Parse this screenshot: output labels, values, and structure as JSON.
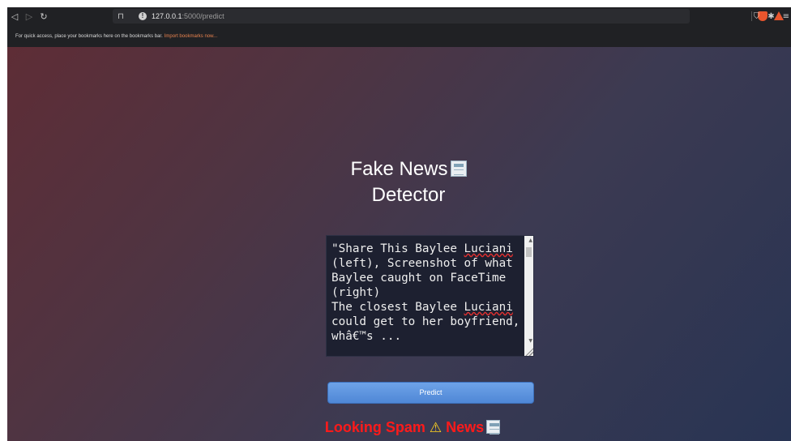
{
  "browser": {
    "url_host": "127.0.0.1",
    "url_path": ":5000/predict"
  },
  "bookmarks_bar": {
    "message": "For quick access, place your bookmarks here on the bookmarks bar.",
    "import_link": "Import bookmarks now..."
  },
  "page": {
    "title_line1": "Fake News",
    "title_line2": "Detector",
    "textarea_lines": [
      "\"Share This Baylee ",
      "Luciani",
      "\n(left), Screenshot of what\nBaylee caught on FaceTime\n(right)\nThe closest Baylee ",
      "Luciani",
      "\ncould get to her boyfriend,\nwhâ€™s ..."
    ],
    "predict_button": "Predict",
    "result_label_1": "Looking Spam",
    "result_label_2": "News"
  },
  "colors": {
    "result_text": "#ff1a1a",
    "button": "#5b93df"
  }
}
